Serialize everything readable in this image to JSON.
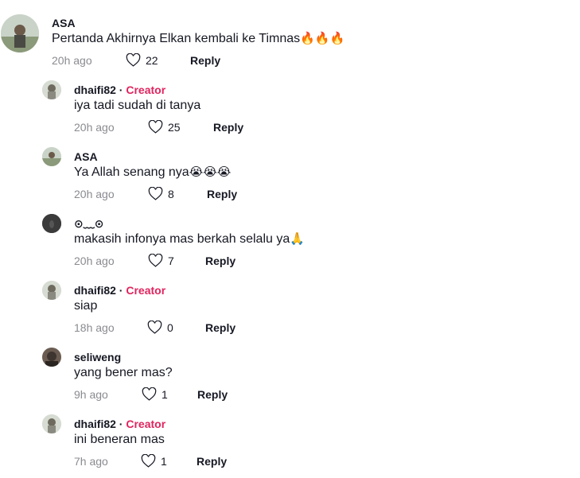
{
  "comments": [
    {
      "user": "ASA",
      "creator": false,
      "text": "Pertanda Akhirnya Elkan kembali ke Timnas",
      "emoji": "🔥🔥🔥",
      "time": "20h ago",
      "likes": "22",
      "reply": "Reply"
    },
    {
      "user": "dhaifi82",
      "creator": true,
      "creator_label": "Creator",
      "text": "iya tadi sudah di tanya",
      "emoji": "",
      "time": "20h ago",
      "likes": "25",
      "reply": "Reply"
    },
    {
      "user": "ASA",
      "creator": false,
      "text": "Ya Allah senang nya",
      "emoji": "😭😭😭",
      "time": "20h ago",
      "likes": "8",
      "reply": "Reply"
    },
    {
      "user": "⊙﹏⊙",
      "creator": false,
      "text": "makasih infonya mas berkah selalu ya",
      "emoji": "🙏",
      "time": "20h ago",
      "likes": "7",
      "reply": "Reply"
    },
    {
      "user": "dhaifi82",
      "creator": true,
      "creator_label": "Creator",
      "text": "siap",
      "emoji": "",
      "time": "18h ago",
      "likes": "0",
      "reply": "Reply"
    },
    {
      "user": "seliweng",
      "creator": false,
      "text": "yang bener mas?",
      "emoji": "",
      "time": "9h ago",
      "likes": "1",
      "reply": "Reply"
    },
    {
      "user": "dhaifi82",
      "creator": true,
      "creator_label": "Creator",
      "text": "ini beneran mas",
      "emoji": "",
      "time": "7h ago",
      "likes": "1",
      "reply": "Reply"
    }
  ],
  "colors": {
    "creator": "#e0245e",
    "meta": "#8a8b91",
    "text": "#161823"
  },
  "icons": {
    "like": "heart-outline-icon"
  }
}
